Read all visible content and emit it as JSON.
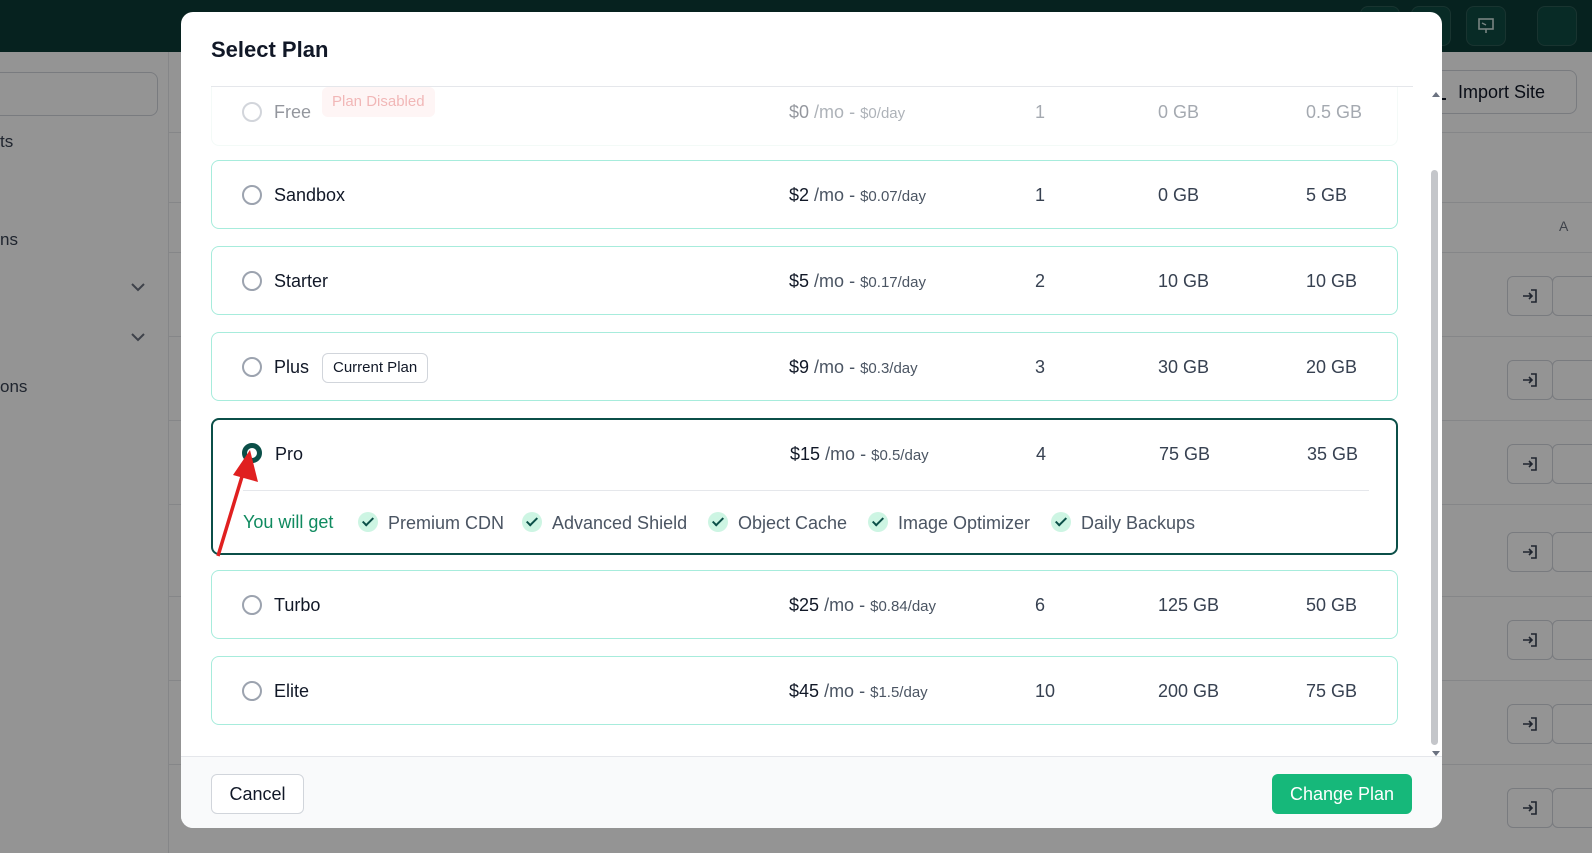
{
  "background": {
    "sidebar_items": [
      "ts",
      "ns",
      "ons"
    ],
    "import_label": "Import Site",
    "column_header": "A"
  },
  "modal": {
    "title": "Select Plan",
    "plans": [
      {
        "name": "Free",
        "badge": "Plan Disabled",
        "price": "$0",
        "per": "/mo",
        "daily": "$0/day",
        "c1": "1",
        "c2": "0 GB",
        "c3": "0.5 GB",
        "state": "disabled"
      },
      {
        "name": "Sandbox",
        "price": "$2",
        "per": "/mo",
        "daily": "$0.07/day",
        "c1": "1",
        "c2": "0 GB",
        "c3": "5 GB",
        "state": "normal"
      },
      {
        "name": "Starter",
        "price": "$5",
        "per": "/mo",
        "daily": "$0.17/day",
        "c1": "2",
        "c2": "10 GB",
        "c3": "10 GB",
        "state": "normal"
      },
      {
        "name": "Plus",
        "badge": "Current Plan",
        "price": "$9",
        "per": "/mo",
        "daily": "$0.3/day",
        "c1": "3",
        "c2": "30 GB",
        "c3": "20 GB",
        "state": "current"
      },
      {
        "name": "Pro",
        "price": "$15",
        "per": "/mo",
        "daily": "$0.5/day",
        "c1": "4",
        "c2": "75 GB",
        "c3": "35 GB",
        "state": "selected"
      },
      {
        "name": "Turbo",
        "price": "$25",
        "per": "/mo",
        "daily": "$0.84/day",
        "c1": "6",
        "c2": "125 GB",
        "c3": "50 GB",
        "state": "normal"
      },
      {
        "name": "Elite",
        "price": "$45",
        "per": "/mo",
        "daily": "$1.5/day",
        "c1": "10",
        "c2": "200 GB",
        "c3": "75 GB",
        "state": "normal"
      }
    ],
    "features_intro": "You will get",
    "features": [
      "Premium CDN",
      "Advanced Shield",
      "Object Cache",
      "Image Optimizer",
      "Daily Backups"
    ],
    "cancel_label": "Cancel",
    "change_label": "Change Plan"
  },
  "colors": {
    "accent": "#0b4f48",
    "primary_button": "#16b87a",
    "plan_border": "#a7ecdc",
    "topbar": "#0b3b36",
    "feature_intro": "#0f8a5f"
  },
  "icons": {
    "radio_selected": "radio-checked-icon",
    "feature_check": "check-circle-icon",
    "row_action": "login-arrow-icon",
    "annotation": "red-arrow-icon"
  }
}
